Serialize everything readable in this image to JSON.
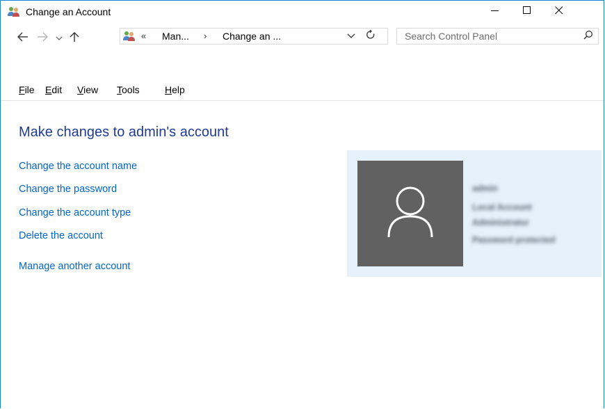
{
  "window": {
    "title": "Change an Account",
    "icon": "user-accounts-icon"
  },
  "caption": {
    "minimize_icon": "minimize-icon",
    "maximize_icon": "maximize-icon",
    "close_icon": "close-icon"
  },
  "nav": {
    "back_icon": "arrow-left-icon",
    "forward_icon": "arrow-right-icon",
    "recent_icon": "chevron-down-icon",
    "up_icon": "arrow-up-icon"
  },
  "address": {
    "overflow": "«",
    "segments": [
      "Man...",
      "Change an ..."
    ],
    "separator": "›"
  },
  "search": {
    "placeholder": "Search Control Panel",
    "value": ""
  },
  "menu": {
    "items": [
      {
        "accel": "F",
        "rest": "ile"
      },
      {
        "accel": "E",
        "rest": "dit"
      },
      {
        "accel": "V",
        "rest": "iew"
      },
      {
        "accel": "T",
        "rest": "ools"
      },
      {
        "accel": "H",
        "rest": "elp"
      }
    ]
  },
  "main": {
    "title": "Make changes to admin's account",
    "tasks": [
      "Change the account name",
      "Change the password",
      "Change the account type",
      "Delete the account"
    ],
    "other_task": "Manage another account"
  },
  "account": {
    "name": "admin",
    "type": "Local Account",
    "role": "Administrator",
    "password_status": "Password protected"
  },
  "colors": {
    "window_border": "#1883d7",
    "link": "#0066cc",
    "title": "#1f3b93",
    "panel_bg": "#e5f1fb",
    "avatar_bg": "#616161"
  }
}
